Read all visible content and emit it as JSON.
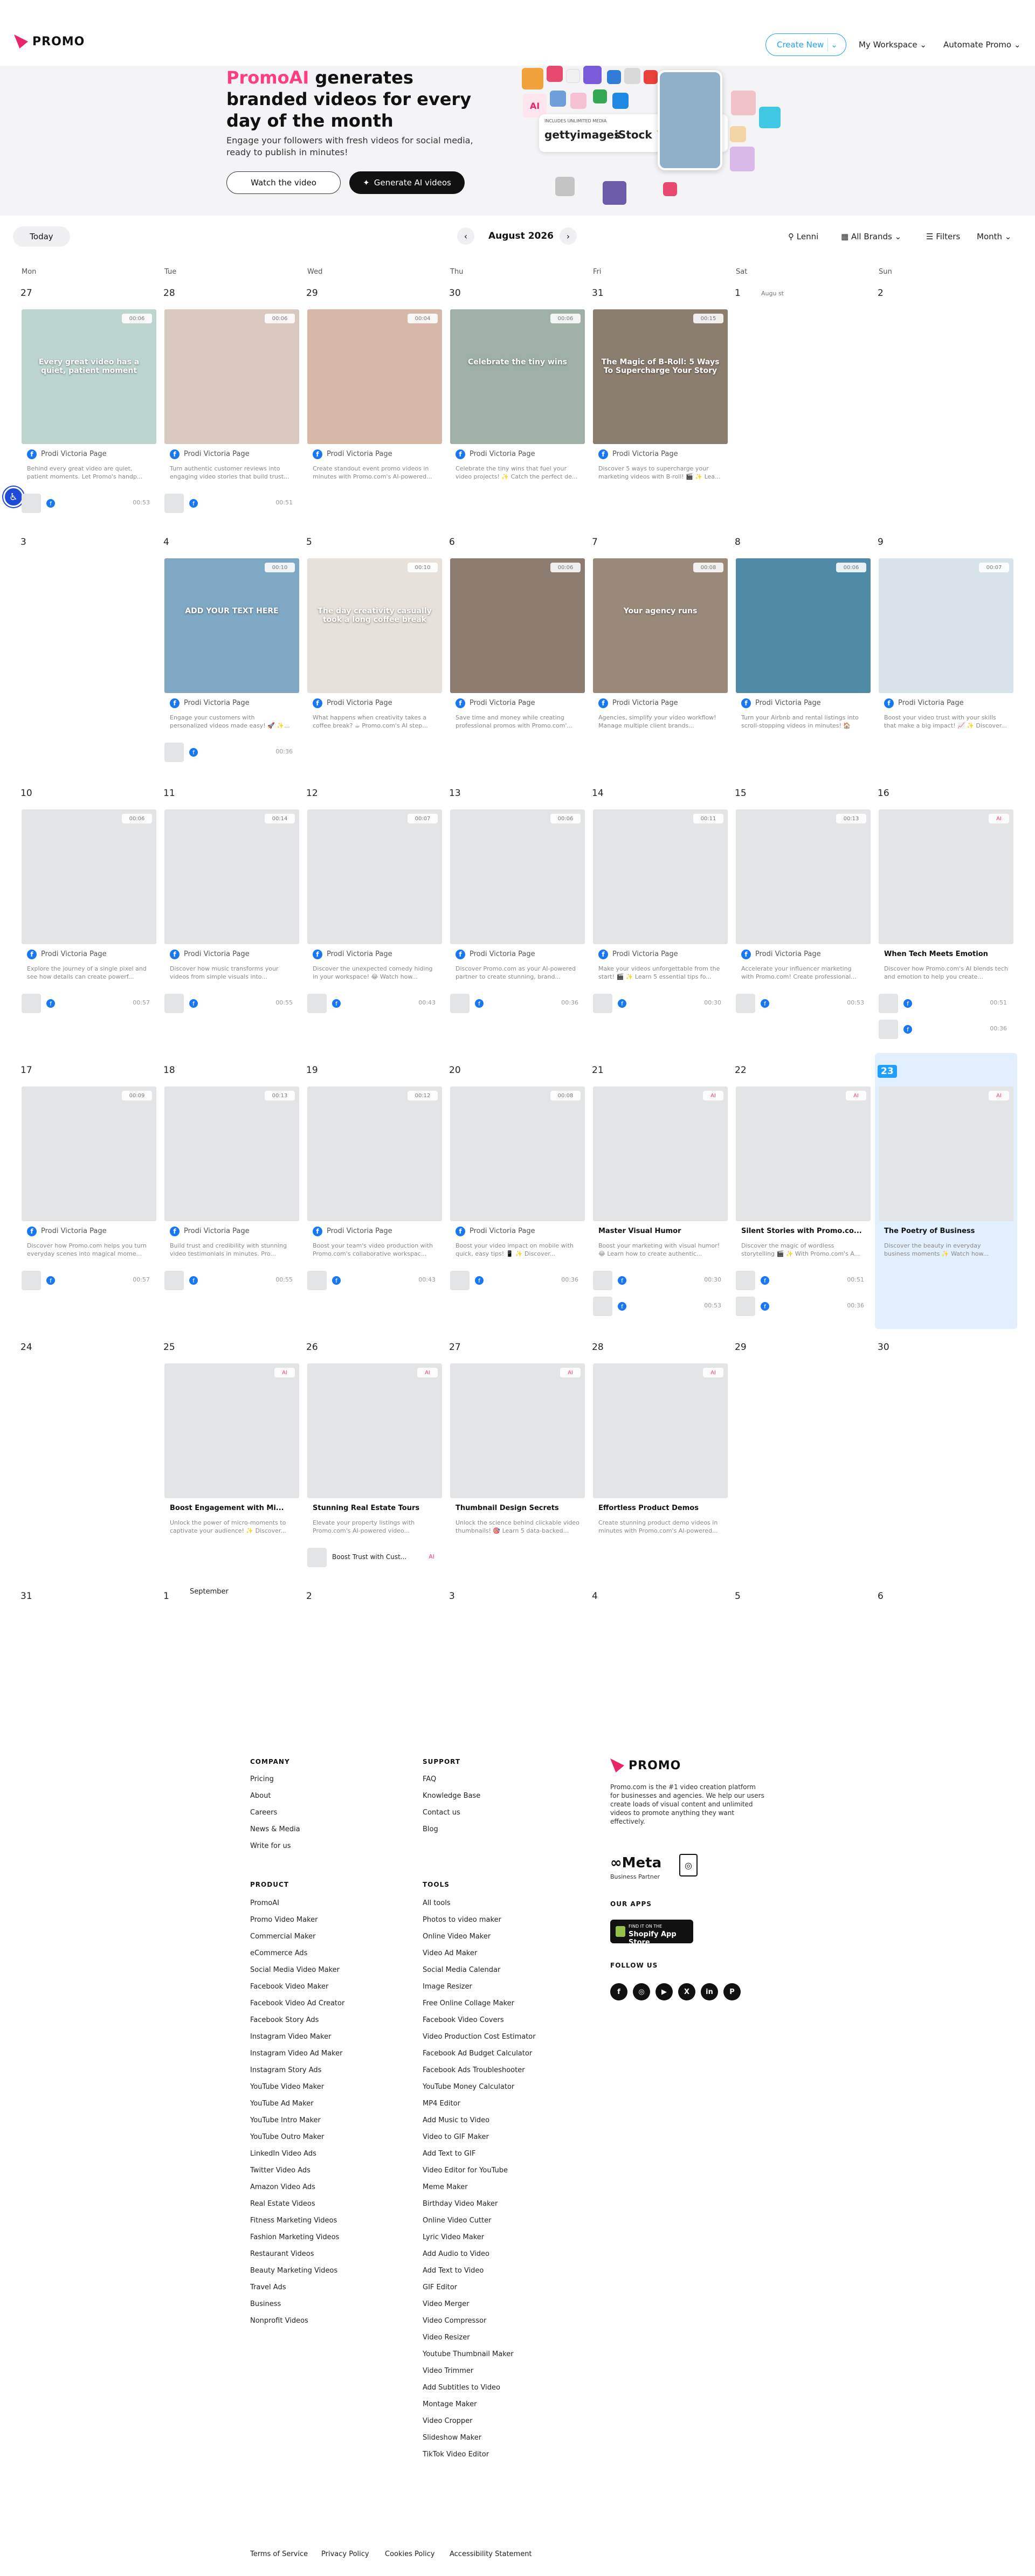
{
  "header": {
    "logo": "PROMO",
    "create_new": "Create New",
    "nav": [
      "My Workspace",
      "Automate Promo"
    ]
  },
  "hero": {
    "title_pink": "PromoAI",
    "title_rest": " generates branded videos for every day of the month",
    "subtitle": "Engage your followers with fresh videos for social media, ready to publish in minutes!",
    "watch_button": "Watch the video",
    "generate_button": "Generate AI videos",
    "collage": {
      "badge": "INCLUDES UNLIMITED MEDIA",
      "getty": "gettyimages",
      "istock": "iStock",
      "ai_tile": "AI"
    }
  },
  "toolbar": {
    "today": "Today",
    "month": "August 2026",
    "location": "Lenni",
    "brands": "All Brands",
    "filters": "Filters",
    "view": "Month"
  },
  "weekdays": [
    "Mon",
    "Tue",
    "Wed",
    "Thu",
    "Fri",
    "Sat",
    "Sun"
  ],
  "weeks": [
    [
      "27",
      "28",
      "29",
      "30",
      "31",
      "1",
      "2"
    ],
    [
      "3",
      "4",
      "5",
      "6",
      "7",
      "8",
      "9"
    ],
    [
      "10",
      "11",
      "12",
      "13",
      "14",
      "15",
      "16"
    ],
    [
      "17",
      "18",
      "19",
      "20",
      "21",
      "22",
      "23"
    ],
    [
      "24",
      "25",
      "26",
      "27",
      "28",
      "29",
      "30"
    ],
    [
      "31",
      "1",
      "2",
      "3",
      "4",
      "5",
      "6"
    ]
  ],
  "aug1_note": "Augu st",
  "sept_label": "September",
  "page_name": "Prodi Victoria Page",
  "posts": [
    {
      "time": "00:06",
      "ds": "Behind every great video are quiet, patient moments. Let Promo's handp...",
      "img": "Every great video has a quiet, patient moment"
    },
    {
      "time": "00:06",
      "ds": "Turn authentic customer reviews into engaging video stories that build trust..."
    },
    {
      "time": "00:04",
      "ds": "Create standout event promo videos in minutes with Promo.com's AI-powered..."
    },
    {
      "time": "00:06",
      "ds": "Celebrate the tiny wins that fuel your video projects! ✨ Catch the perfect de...",
      "img": "Celebrate the tiny wins"
    },
    {
      "time": "00:15",
      "ds": "Discover 5 ways to supercharge your marketing videos with B-roll! 🎬 ✨ Lea...",
      "img": "The Magic of B-Roll: 5 Ways To Supercharge Your Story"
    },
    {
      "time": "00:10",
      "ds": "Engage your customers with personalized videos made easy! 🚀 ✨...",
      "img": "ADD YOUR TEXT HERE"
    },
    {
      "time": "00:10",
      "ds": "What happens when creativity takes a coffee break? ☕ Promo.com's AI step...",
      "img": "The day creativity casually took a long coffee break"
    },
    {
      "time": "00:06",
      "ds": "Save time and money while creating professional promos with Promo.com'..."
    },
    {
      "time": "00:08",
      "ds": "Agencies, simplify your video workflow! Manage multiple client brands...",
      "img": "Your agency runs"
    },
    {
      "time": "00:06",
      "ds": "Turn your Airbnb and rental listings into scroll-stopping videos in minutes! 🏠 ✨..."
    },
    {
      "time": "00:07",
      "ds": "Boost your video trust with your skills that make a big impact! 📈 ✨ Discover..."
    },
    {
      "time": "00:06",
      "ds": "Explore the journey of a single pixel and see how details can create powerf..."
    },
    {
      "time": "00:14",
      "ds": "Discover how music transforms your videos from simple visuals into..."
    },
    {
      "time": "00:07",
      "ds": "Discover the unexpected comedy hiding in your workspace! 😂 Watch how..."
    },
    {
      "time": "00:06",
      "ds": "Discover Promo.com as your AI-powered partner to create stunning, brand..."
    },
    {
      "time": "00:11",
      "ds": "Make your videos unforgettable from the start! 🎬 ✨ Learn 5 essential tips fo..."
    },
    {
      "time": "00:13",
      "ds": "Accelerate your influencer marketing with Promo.com! Create professional..."
    },
    {
      "time": "00:09",
      "ds": "Discover how Promo.com helps you turn everyday scenes into magical mome..."
    },
    {
      "time": "00:13",
      "ds": "Build trust and credibility with stunning video testimonials in minutes. Pro..."
    },
    {
      "time": "00:12",
      "ds": "Boost your team's video production with Promo.com's collaborative workspac..."
    },
    {
      "time": "00:08",
      "ds": "Boost your video impact on mobile with quick, easy tips! 📱 ✨ Discover..."
    }
  ],
  "ai_posts": [
    {
      "title": "When Tech Meets Emotion",
      "ds": "Discover how Promo.com's AI blends tech and emotion to help you create...",
      "tag": "AI"
    },
    {
      "title": "Master Visual Humor",
      "ds": "Boost your marketing with visual humor! 😂 Learn how to create authentic...",
      "tag": "AI"
    },
    {
      "title": "Silent Stories with Promo.co...",
      "ds": "Discover the magic of wordless storytelling 🎬 ✨ With Promo.com's A...",
      "tag": "AI"
    },
    {
      "title": "The Poetry of Business",
      "ds": "Discover the beauty in everyday business moments ✨ Watch how...",
      "tag": "AI"
    },
    {
      "title": "Boost Engagement with Mi...",
      "ds": "Unlock the power of micro-moments to captivate your audience! ✨ Discover...",
      "tag": "AI"
    },
    {
      "title": "Stunning Real Estate Tours",
      "ds": "Elevate your property listings with Promo.com's AI-powered video...",
      "tag": "AI"
    },
    {
      "title": "Thumbnail Design Secrets",
      "ds": "Unlock the science behind clickable video thumbnails! 🎯 Learn 5 data-backed...",
      "tag": "AI"
    },
    {
      "title": "Effortless Product Demos",
      "ds": "Create stunning product demo videos in minutes with Promo.com's AI-powered...",
      "tag": "AI"
    }
  ],
  "extra_rows": [
    {
      "time": "00:53"
    },
    {
      "time": "00:51"
    },
    {
      "time": "00:36"
    },
    {
      "time": "00:57"
    },
    {
      "time": "00:55"
    },
    {
      "time": "00:43"
    },
    {
      "time": "00:36"
    },
    {
      "time": "00:30"
    }
  ],
  "mini_post": {
    "label": "Boost Trust with Cust...",
    "tag": "AI"
  },
  "footer": {
    "company_h": "COMPANY",
    "company": [
      "Pricing",
      "About",
      "Careers",
      "News & Media",
      "Write for us"
    ],
    "support_h": "SUPPORT",
    "support": [
      "FAQ",
      "Knowledge Base",
      "Contact us",
      "Blog"
    ],
    "product_h": "PRODUCT",
    "product": [
      "PromoAI",
      "Promo Video Maker",
      "Commercial Maker",
      "eCommerce Ads",
      "Social Media Video Maker",
      "Facebook Video Maker",
      "Facebook Video Ad Creator",
      "Facebook Story Ads",
      "Instagram Video Maker",
      "Instagram Video Ad Maker",
      "Instagram Story Ads",
      "YouTube Video Maker",
      "YouTube Ad Maker",
      "YouTube Intro Maker",
      "YouTube Outro Maker",
      "LinkedIn Video Ads",
      "Twitter Video Ads",
      "Amazon Video Ads",
      "Real Estate Videos",
      "Fitness Marketing Videos",
      "Fashion Marketing Videos",
      "Restaurant Videos",
      "Beauty Marketing Videos",
      "Travel Ads",
      "Business",
      "Nonprofit Videos"
    ],
    "tools_h": "TOOLS",
    "tools": [
      "All tools",
      "Photos to video maker",
      "Online Video Maker",
      "Video Ad Maker",
      "Social Media Calendar",
      "Image Resizer",
      "Free Online Collage Maker",
      "Facebook Video Covers",
      "Video Production Cost Estimator",
      "Facebook Ad Budget Calculator",
      "Facebook Ads Troubleshooter",
      "YouTube Money Calculator",
      "MP4 Editor",
      "Add Music to Video",
      "Video to GIF Maker",
      "Add Text to GIF",
      "Video Editor for YouTube",
      "Meme Maker",
      "Birthday Video Maker",
      "Online Video Cutter",
      "Lyric Video Maker",
      "Add Audio to Video",
      "Add Text to Video",
      "GIF Editor",
      "Video Merger",
      "Video Compressor",
      "Video Resizer",
      "Youtube Thumbnail Maker",
      "Video Trimmer",
      "Add Subtitles to Video",
      "Montage Maker",
      "Video Cropper",
      "Slideshow Maker",
      "TikTok Video Editor"
    ],
    "logo": "PROMO",
    "desc": "Promo.com is the #1 video creation platform for businesses and agencies. We help our users create loads of visual content and unlimited videos to promote anything they want effectively.",
    "meta": "∞Meta",
    "meta_sub": "Business Partner",
    "apps_h": "OUR APPS",
    "shopify_1": "FIND IT ON THE",
    "shopify_2": "Shopify App Store",
    "follow_h": "FOLLOW US",
    "social": [
      "f",
      "◎",
      "▶",
      "X",
      "in",
      "P"
    ],
    "legal": [
      "Terms of Service",
      "Privacy Policy",
      "Cookies Policy",
      "Accessibility Statement"
    ]
  }
}
